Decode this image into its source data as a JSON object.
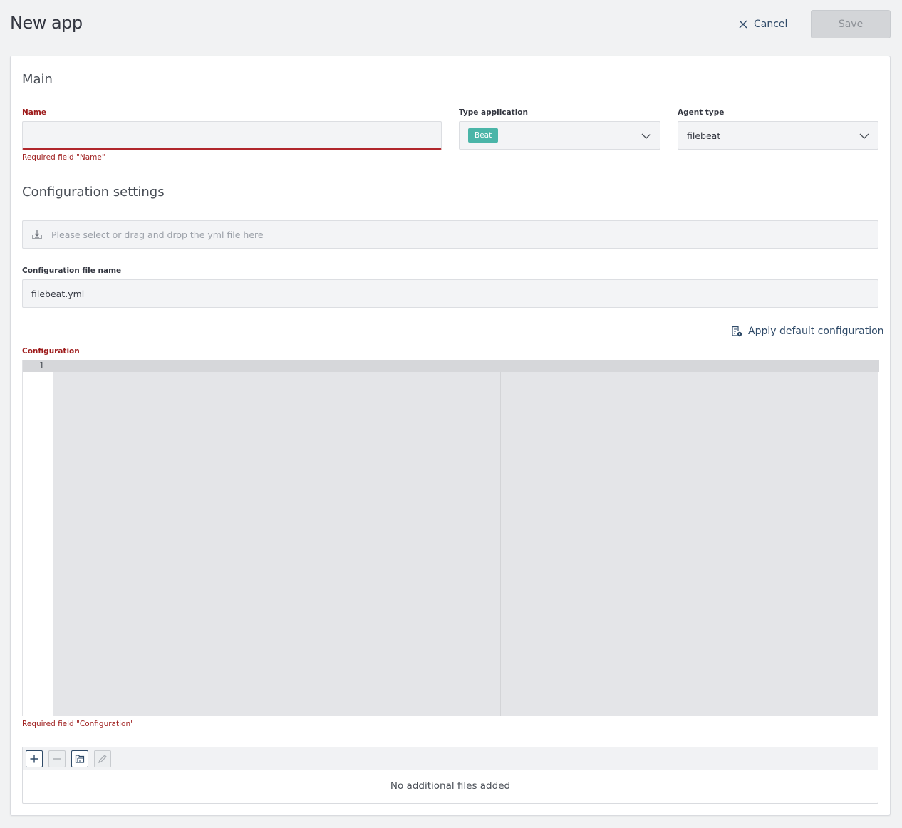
{
  "header": {
    "title": "New app",
    "cancel_label": "Cancel",
    "save_label": "Save"
  },
  "main": {
    "section_title": "Main",
    "name": {
      "label": "Name",
      "value": "",
      "error": "Required field \"Name\""
    },
    "type_application": {
      "label": "Type application",
      "selected": "Beat"
    },
    "agent_type": {
      "label": "Agent type",
      "selected": "filebeat"
    }
  },
  "configuration_settings": {
    "section_title": "Configuration settings",
    "dropzone_placeholder": "Please select or drag and drop the yml file here",
    "file_name": {
      "label": "Configuration file name",
      "value": "filebeat.yml"
    },
    "apply_default_label": "Apply default configuration",
    "configuration": {
      "label": "Configuration",
      "line_number": "1",
      "error": "Required field \"Configuration\""
    }
  },
  "additional_files": {
    "empty_text": "No additional files added",
    "toolbar": [
      "plus-icon",
      "minus-icon",
      "folder-icon",
      "pencil-icon"
    ]
  },
  "colors": {
    "error": "#9e1c1c",
    "accent": "#2f4a68",
    "badge": "#4ab5a8"
  }
}
